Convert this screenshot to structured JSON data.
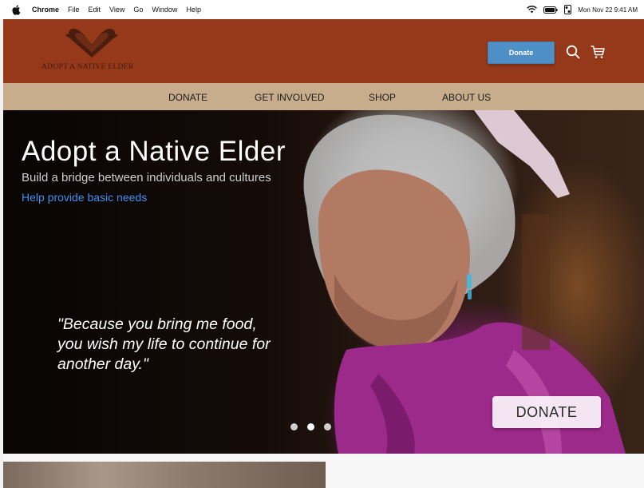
{
  "menubar": {
    "app_name": "Chrome",
    "items": [
      "File",
      "Edit",
      "View",
      "Go",
      "Window",
      "Help"
    ],
    "clock": "Mon Nov 22  9:41 AM"
  },
  "header": {
    "brand": "ADOPT A NATIVE ELDER",
    "donate_label": "Donate",
    "colors": {
      "header_bg": "#96391a",
      "button_bg": "#4e8fc6"
    }
  },
  "nav": {
    "items": [
      "DONATE",
      "GET INVOLVED",
      "SHOP",
      "ABOUT US"
    ],
    "bg": "#c8ad8c"
  },
  "hero": {
    "title": "Adopt a Native Elder",
    "subtitle": "Build a bridge between individuals and cultures",
    "link": "Help provide basic needs",
    "quote": "\"Because you bring me food, you wish my life to continue for another day.\"",
    "donate_label": "DONATE",
    "carousel_slides": 3,
    "active_slide": 2
  },
  "icons": {
    "search": "search-icon",
    "cart": "cart-icon",
    "logo": "hands-heart-logo"
  }
}
